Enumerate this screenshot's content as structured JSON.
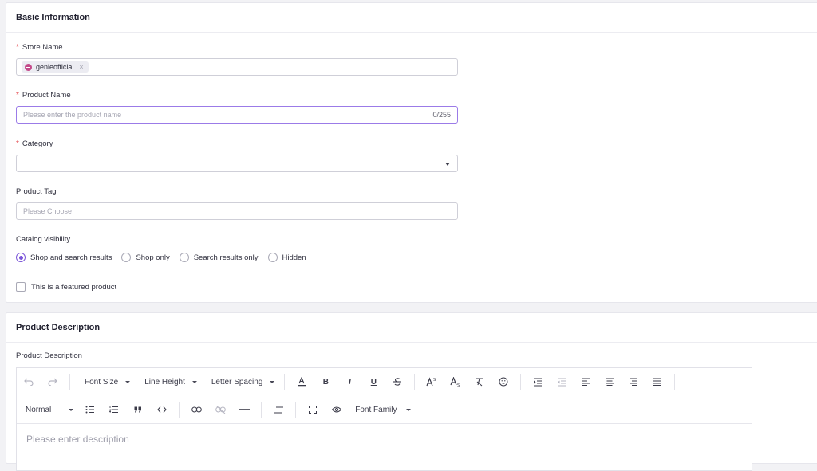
{
  "basic": {
    "title": "Basic Information",
    "store": {
      "label": "Store Name",
      "required": "*",
      "tag": "genieofficial",
      "tag_close": "×"
    },
    "product": {
      "label": "Product Name",
      "required": "*",
      "placeholder": "Please enter the product name",
      "counter": "0/255"
    },
    "category": {
      "label": "Category",
      "required": "*"
    },
    "tag": {
      "label": "Product Tag",
      "placeholder": "Please Choose"
    },
    "visibility": {
      "label": "Catalog visibility",
      "options": [
        "Shop and search results",
        "Shop only",
        "Search results only",
        "Hidden"
      ],
      "selected": "Shop and search results"
    },
    "featured": {
      "label": "This is a featured product"
    }
  },
  "description": {
    "title": "Product Description",
    "label": "Product Description",
    "placeholder": "Please enter description",
    "toolbar": {
      "font_size": "Font Size",
      "line_height": "Line Height",
      "letter_spacing": "Letter Spacing",
      "bold": "B",
      "italic": "I",
      "underline": "U",
      "paragraph": "Normal",
      "font_family": "Font Family"
    }
  },
  "colors": {
    "accent": "#7b55d9",
    "required": "#e5484d",
    "focus_border": "#9b7be8"
  }
}
